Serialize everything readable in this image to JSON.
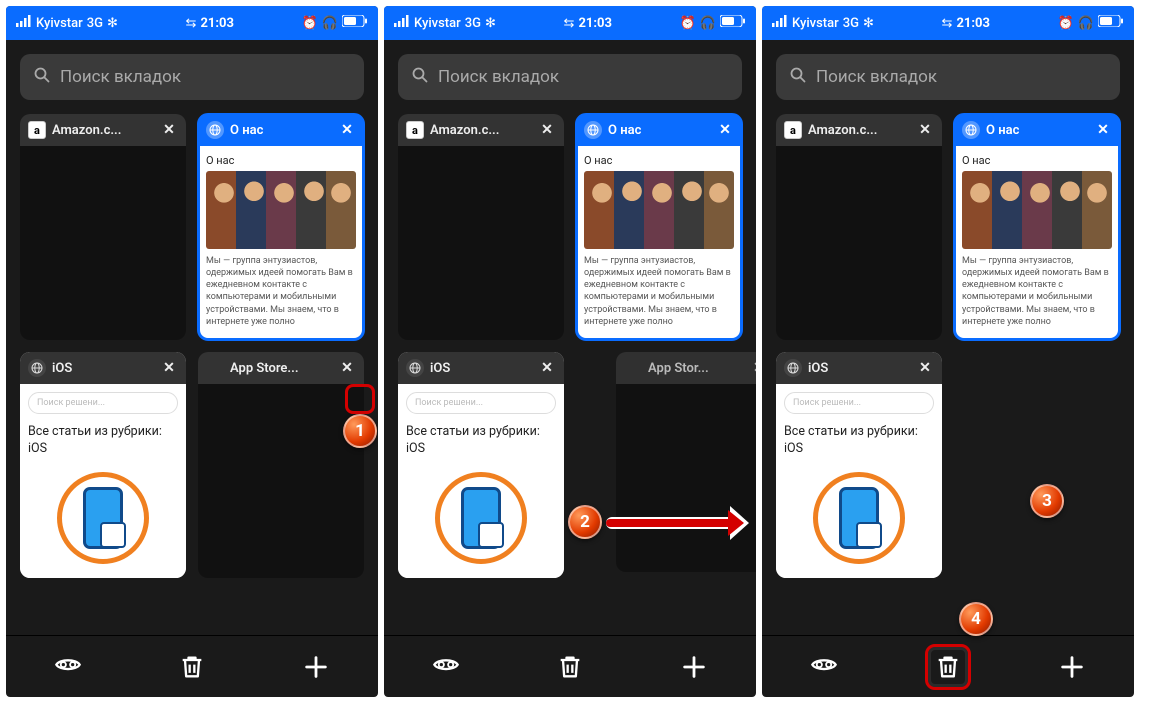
{
  "status": {
    "carrier": "Kyivstar",
    "network": "3G",
    "time": "21:03"
  },
  "search": {
    "placeholder": "Поиск вкладок"
  },
  "tabs": {
    "amazon": {
      "title": "Amazon.c..."
    },
    "about": {
      "title": "О нас",
      "heading": "О нас",
      "text": "Мы — группа энтузиастов, одержимых идеей помогать Вам в ежедневном контакте с компьютерами и мобильными устройствами. Мы знаем, что в интернете уже полно"
    },
    "ios": {
      "title": "iOS",
      "search_placeholder": "Поиск решени...",
      "heading": "Все статьи из рубрики: iOS"
    },
    "appstore": {
      "title": "App Store..."
    },
    "appstore_partial": {
      "title": "App Stor..."
    }
  },
  "markers": {
    "m1": "1",
    "m2": "2",
    "m3": "3",
    "m4": "4"
  },
  "favicons": {
    "amazon": "a",
    "apple": ""
  }
}
